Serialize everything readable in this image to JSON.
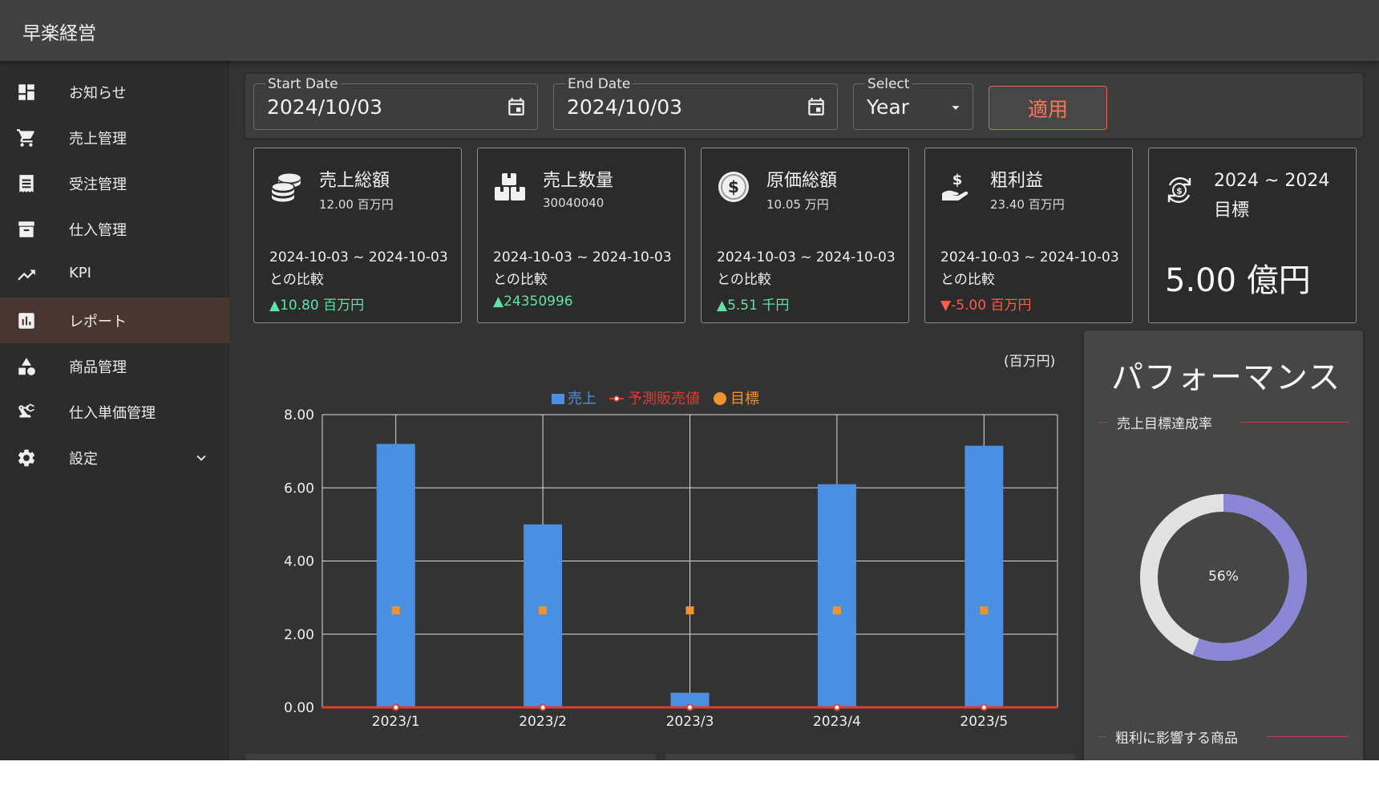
{
  "app": {
    "title": "早楽経営"
  },
  "sidebar": {
    "items": [
      {
        "label": "お知らせ",
        "icon": "dashboard-icon"
      },
      {
        "label": "売上管理",
        "icon": "cart-icon"
      },
      {
        "label": "受注管理",
        "icon": "receipt-icon"
      },
      {
        "label": "仕入管理",
        "icon": "archive-icon"
      },
      {
        "label": "KPI",
        "icon": "trending-up-icon"
      },
      {
        "label": "レポート",
        "icon": "bar-chart-icon",
        "active": true
      },
      {
        "label": "商品管理",
        "icon": "category-icon"
      },
      {
        "label": "仕入単価管理",
        "icon": "precision-icon"
      },
      {
        "label": "設定",
        "icon": "gear-icon",
        "expandable": true
      }
    ]
  },
  "filters": {
    "start_date": {
      "label": "Start Date",
      "value": "2024/10/03"
    },
    "end_date": {
      "label": "End Date",
      "value": "2024/10/03"
    },
    "select": {
      "label": "Select",
      "value": "Year"
    },
    "apply_label": "適用"
  },
  "cards": [
    {
      "title": "売上総額",
      "sub": "12.00 百万円",
      "range": "2024-10-03 ~ 2024-10-03との比較",
      "delta": "▲10.80 百万円",
      "direction": "up",
      "icon": "coins-icon"
    },
    {
      "title": "売上数量",
      "sub": "30040040",
      "range": "2024-10-03 ~ 2024-10-03との比較",
      "delta": "▲24350996",
      "direction": "up",
      "icon": "boxes-icon"
    },
    {
      "title": "原価総額",
      "sub": "10.05 万円",
      "range": "2024-10-03 ~ 2024-10-03との比較",
      "delta": "▲5.51 千円",
      "direction": "up",
      "icon": "dollar-circle-icon"
    },
    {
      "title": "粗利益",
      "sub": "23.40 百万円",
      "range": "2024-10-03 ~ 2024-10-03との比較",
      "delta": "▼-5.00 百万円",
      "direction": "down",
      "icon": "hand-money-icon"
    }
  ],
  "target_card": {
    "period": "2024 ~ 2024 目標",
    "value": "5.00 億円",
    "icon": "dollar-cycle-icon"
  },
  "chart_unit": "(百万円)",
  "chart_data": {
    "type": "bar",
    "categories": [
      "2023/1",
      "2023/2",
      "2023/3",
      "2023/4",
      "2023/5"
    ],
    "series": [
      {
        "name": "売上",
        "type": "bar",
        "color": "#4a90e2",
        "values": [
          7.2,
          5.0,
          0.4,
          6.1,
          7.15
        ]
      },
      {
        "name": "予測販売値",
        "type": "line",
        "color": "#e53a2f",
        "values": [
          0,
          0,
          0,
          0,
          0
        ]
      },
      {
        "name": "目標",
        "type": "scatter",
        "color": "#f0932b",
        "values": [
          2.65,
          2.65,
          2.65,
          2.65,
          2.65
        ]
      }
    ],
    "ylim": [
      0,
      8
    ],
    "yticks": [
      "0.00",
      "2.00",
      "4.00",
      "6.00",
      "8.00"
    ],
    "legend": "top-center",
    "grid": true
  },
  "performance": {
    "title": "パフォーマンス",
    "achievement_label": "売上目標達成率",
    "achievement_percent": 56,
    "achievement_text": "56%",
    "products_label": "粗利に影響する商品",
    "colors": {
      "filled": "#8b87d6",
      "remaining": "#e2e2e2"
    }
  }
}
